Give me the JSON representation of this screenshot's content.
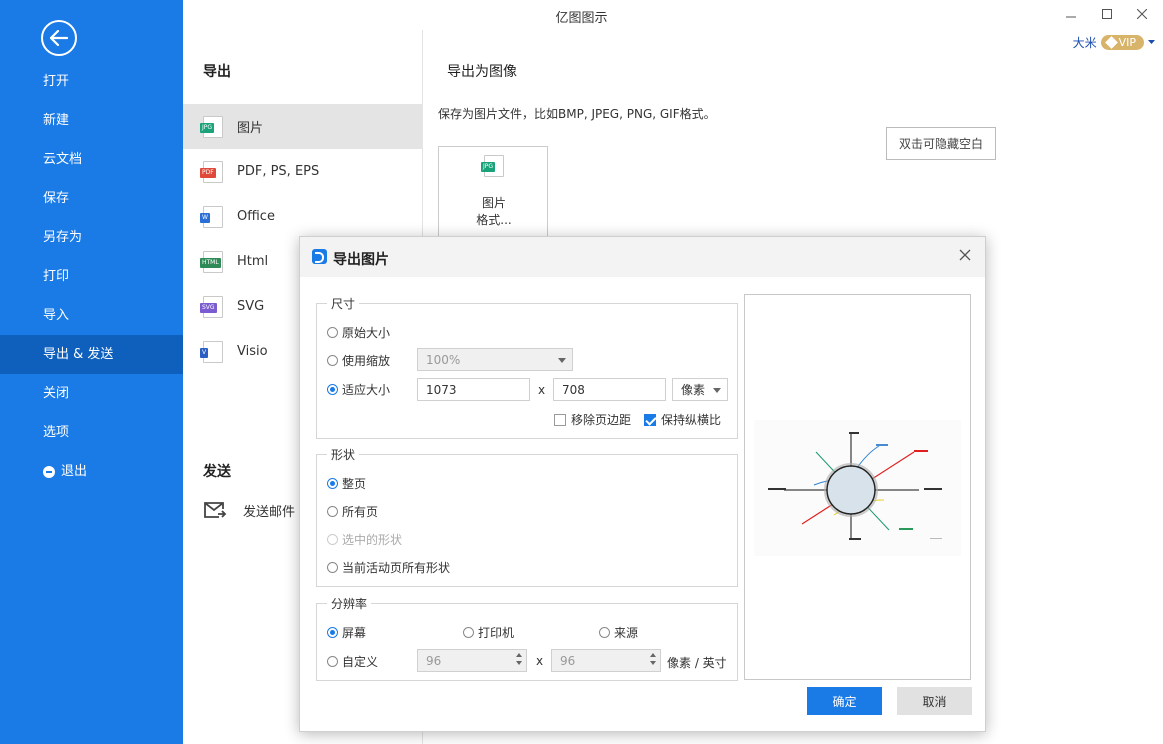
{
  "app": {
    "title": "亿图图示"
  },
  "user": {
    "name": "大米",
    "badge": "VIP"
  },
  "sidebar": {
    "items": [
      {
        "label": "打开"
      },
      {
        "label": "新建"
      },
      {
        "label": "云文档"
      },
      {
        "label": "保存"
      },
      {
        "label": "另存为"
      },
      {
        "label": "打印"
      },
      {
        "label": "导入"
      },
      {
        "label": "导出 & 发送"
      },
      {
        "label": "关闭"
      },
      {
        "label": "选项"
      },
      {
        "label": "退出"
      }
    ]
  },
  "export_panel": {
    "heading": "导出",
    "items": [
      {
        "label": "图片",
        "icon": "JPG",
        "color": "#1aa37a"
      },
      {
        "label": "PDF, PS, EPS",
        "icon": "PDF",
        "color": "#e0493a"
      },
      {
        "label": "Office",
        "icon": "W",
        "color": "#2b6fd6"
      },
      {
        "label": "Html",
        "icon": "HTML",
        "color": "#2e8b57"
      },
      {
        "label": "SVG",
        "icon": "SVG",
        "color": "#7a5bd1"
      },
      {
        "label": "Visio",
        "icon": "V",
        "color": "#2b5fc4"
      }
    ],
    "send_heading": "发送",
    "send_mail": "发送邮件"
  },
  "right": {
    "heading": "导出为图像",
    "description": "保存为图片文件，比如BMP, JPEG, PNG, GIF格式。",
    "hide_blank": "双击可隐藏空白",
    "card_line1": "图片",
    "card_line2": "格式...",
    "card_icon": "JPG"
  },
  "dialog": {
    "title": "导出图片",
    "size_group": "尺寸",
    "original_size": "原始大小",
    "use_zoom": "使用缩放",
    "zoom_value": "100%",
    "fit_size": "适应大小",
    "width": "1073",
    "x": "x",
    "height": "708",
    "unit": "像素",
    "remove_margin": "移除页边距",
    "keep_ratio": "保持纵横比",
    "shape_group": "形状",
    "whole_page": "整页",
    "all_pages": "所有页",
    "selected_shapes": "选中的形状",
    "current_page_shapes": "当前活动页所有形状",
    "resolution_group": "分辨率",
    "screen": "屏幕",
    "printer": "打印机",
    "source": "来源",
    "custom": "自定义",
    "dpi_x": "96",
    "dpi_y": "96",
    "dpi_unit": "像素 / 英寸",
    "ok": "确定",
    "cancel": "取消"
  }
}
